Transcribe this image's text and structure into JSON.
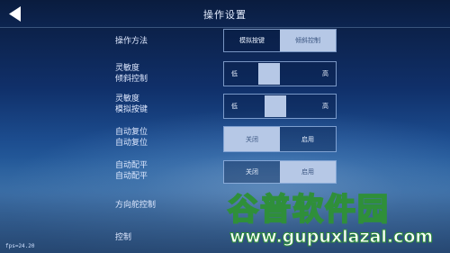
{
  "header": {
    "title": "操作设置"
  },
  "settings": {
    "control_method": {
      "label": "操作方法",
      "options": [
        "模拟按键",
        "倾斜控制"
      ],
      "selected": 1
    },
    "sensitivity_tilt": {
      "label_line1": "灵敏度",
      "label_line2": "倾斜控制",
      "low": "低",
      "high": "高",
      "level": 0.38
    },
    "sensitivity_keys": {
      "label_line1": "灵敏度",
      "label_line2": "模拟按键",
      "low": "低",
      "high": "高",
      "level": 0.45
    },
    "auto_reset": {
      "label_line1": "自动复位",
      "label_line2": "自动复位",
      "options": [
        "关闭",
        "启用"
      ],
      "selected": 0
    },
    "auto_trim": {
      "label_line1": "自动配平",
      "label_line2": "自动配平",
      "options": [
        "关闭",
        "启用"
      ],
      "selected": 1
    },
    "rudder_control": {
      "label": "方向舵控制"
    },
    "control": {
      "label": "控制"
    }
  },
  "fps_text": "fps=24.20",
  "watermark": {
    "cn": "谷普软件园",
    "url": "www.gupuxlazal.com"
  },
  "colors": {
    "active_segment": "#b6c8e6",
    "border": "#b4d2ff",
    "watermark_green": "#2f8f3a"
  }
}
